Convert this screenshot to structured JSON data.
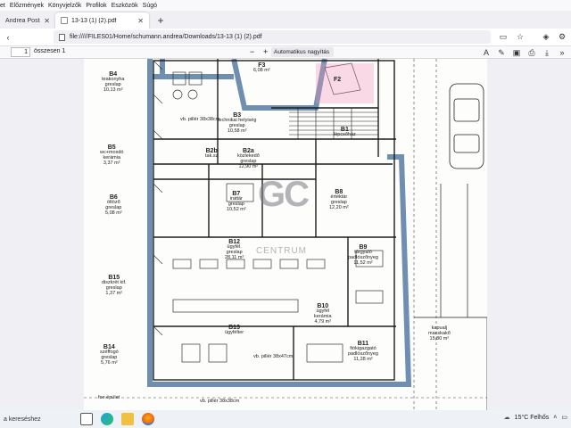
{
  "menubar": {
    "items": [
      "et",
      "Előzmények",
      "Könyvjelzők",
      "Profilok",
      "Eszközök",
      "Súgó"
    ]
  },
  "tabs": [
    {
      "label": "Andrea Posta nézet",
      "active": false
    },
    {
      "label": "13-13 (1) (2).pdf",
      "active": true
    }
  ],
  "navbar": {
    "url": "file://///FILES01/Home/schumann.andrea/Downloads/13-13 (1) (2).pdf"
  },
  "pdf_toolbar": {
    "page_value": "1",
    "page_total": "összesen 1",
    "zoom": "Automatikus nagyítás"
  },
  "plan": {
    "watermark": "GC",
    "watermark_sub": "CENTRUM",
    "rooms": [
      {
        "id": "B4",
        "name": "teakonyha",
        "floor": "greslap",
        "area": "10,13 m²"
      },
      {
        "id": "B3",
        "name": "technikai helyiség",
        "floor": "greslap",
        "area": "10,58 m²"
      },
      {
        "id": "B5",
        "name": "wc+mosdó",
        "floor": "kerámia",
        "area": "3,37 m²"
      },
      {
        "id": "B2b",
        "name": "tak.sz",
        "floor": "",
        "area": ""
      },
      {
        "id": "B2a",
        "name": "közlekedő",
        "floor": "greslap",
        "area": "12,90 m²"
      },
      {
        "id": "B1",
        "name": "lépcsőház",
        "floor": "",
        "area": ""
      },
      {
        "id": "B6",
        "name": "öltöző",
        "floor": "greslap",
        "area": "5,08 m²"
      },
      {
        "id": "B7",
        "name": "irattár",
        "floor": "greslap",
        "area": "10,52 m²"
      },
      {
        "id": "B8",
        "name": "értéktár",
        "floor": "greslap",
        "area": "12,20 m²"
      },
      {
        "id": "B12",
        "name": "ügyfél.",
        "floor": "greslap",
        "area": "28,11 m²"
      },
      {
        "id": "B9",
        "name": "tárgyaló",
        "floor": "padlószőnyeg",
        "area": "11,52 m²"
      },
      {
        "id": "B15",
        "name": "diszkrét kif.",
        "floor": "greslap",
        "area": "1,37 m²"
      },
      {
        "id": "B10",
        "name": "ügyfél",
        "floor": "kerámia",
        "area": "4,79 m²"
      },
      {
        "id": "B13",
        "name": "ügyfélter",
        "floor": "",
        "area": ""
      },
      {
        "id": "B14",
        "name": "széffogó",
        "floor": "greslap",
        "area": "5,76 m²"
      },
      {
        "id": "B11",
        "name": "fiókigazgató",
        "floor": "padlószőnyeg",
        "area": "11,28 m²"
      },
      {
        "id": "F3",
        "name": "",
        "floor": "",
        "area": "6,08 m²"
      },
      {
        "id": "F2",
        "name": "",
        "floor": "",
        "area": ""
      },
      {
        "id": "kapualj",
        "name": "kapualj",
        "floor": "macskakő",
        "area": "15,80 m²"
      }
    ],
    "annotations": [
      "vb. pillér 38x38cm",
      "vb. pillér 38x47cm",
      "vb. pillér 38x38cm",
      "foe épület"
    ]
  },
  "taskbar": {
    "search_text": "a kereséshez",
    "weather": "15°C Felhős"
  }
}
